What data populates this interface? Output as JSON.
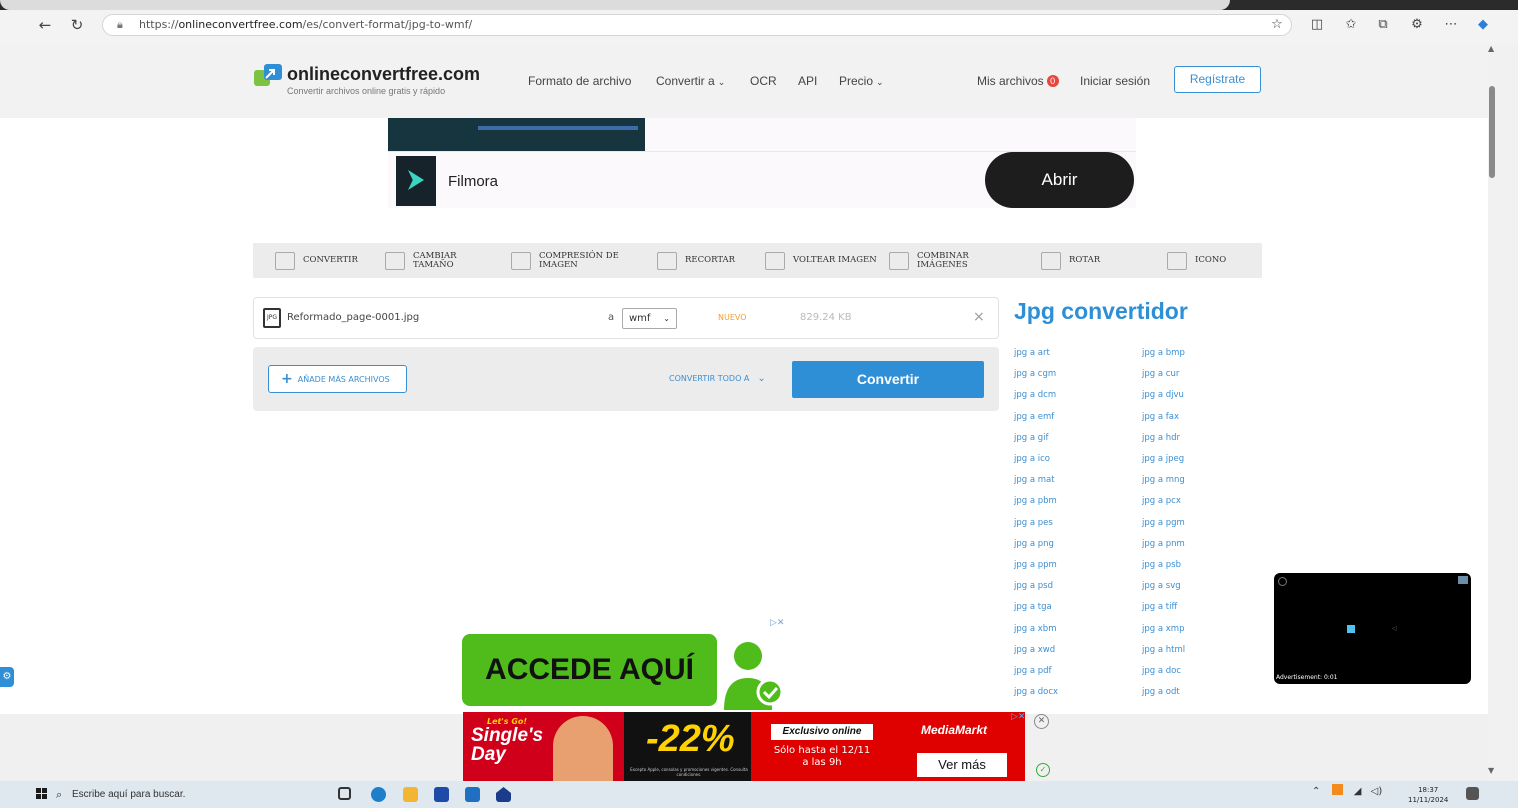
{
  "browser": {
    "url_prefix": "https://",
    "url_host": "onlineconvertfree.com",
    "url_path": "/es/convert-format/jpg-to-wmf/"
  },
  "site": {
    "logo_name": "onlineconvertfree.com",
    "logo_tagline": "Convertir archivos online gratis y rápido",
    "nav": {
      "formato": "Formato de archivo",
      "convertir_a": "Convertir a",
      "ocr": "OCR",
      "api": "API",
      "precio": "Precio"
    },
    "mis_archivos": "Mis archivos",
    "mis_archivos_count": "0",
    "login": "Iniciar sesión",
    "register": "Regístrate"
  },
  "ad_top": {
    "app_name": "Filmora",
    "button": "Abrir"
  },
  "tools": [
    {
      "label": "CONVERTIR",
      "icon": "convert-icon"
    },
    {
      "label": "CAMBIAR TAMAÑO",
      "icon": "resize-icon"
    },
    {
      "label": "COMPRESIÓN DE IMAGEN",
      "icon": "compress-icon"
    },
    {
      "label": "RECORTAR",
      "icon": "crop-icon"
    },
    {
      "label": "VOLTEAR IMAGEN",
      "icon": "flip-icon"
    },
    {
      "label": "COMBINAR IMÁGENES",
      "icon": "combine-icon"
    },
    {
      "label": "ROTAR",
      "icon": "rotate-icon"
    },
    {
      "label": "ICONO",
      "icon": "ico-icon"
    }
  ],
  "converter": {
    "file_icon": "JPG",
    "file_name": "Reformado_page-0001.jpg",
    "to_label": "a",
    "format_selected": "wmf",
    "new_badge": "NUEVO",
    "file_size": "829.24 KB",
    "add_files": "AÑADE MÁS ARCHIVOS",
    "convert_all": "CONVERTIR TODO A",
    "convert_button": "Convertir"
  },
  "jpg_converter": {
    "title": "Jpg convertidor",
    "col1": [
      "jpg a art",
      "jpg a cgm",
      "jpg a dcm",
      "jpg a emf",
      "jpg a gif",
      "jpg a ico",
      "jpg a mat",
      "jpg a pbm",
      "jpg a pes",
      "jpg a png",
      "jpg a ppm",
      "jpg a psd",
      "jpg a tga",
      "jpg a xbm",
      "jpg a xwd",
      "jpg a pdf",
      "jpg a docx"
    ],
    "col2": [
      "jpg a bmp",
      "jpg a cur",
      "jpg a djvu",
      "jpg a fax",
      "jpg a hdr",
      "jpg a jpeg",
      "jpg a mng",
      "jpg a pcx",
      "jpg a pgm",
      "jpg a pnm",
      "jpg a psb",
      "jpg a svg",
      "jpg a tiff",
      "jpg a xmp",
      "jpg a html",
      "jpg a doc",
      "jpg a odt"
    ]
  },
  "ads": {
    "accede": "ACCEDE AQUÍ",
    "mm_lets": "Let's Go!",
    "mm_single1": "Single's",
    "mm_single2": "Day",
    "mm_discount": "-22%",
    "mm_small": "Excepto Apple, consolas y promociones vigentes. Consulta condiciones.",
    "mm_excl": "Exclusivo online",
    "mm_until1": "Sólo hasta el 12/11",
    "mm_until2": "a las 9h",
    "mm_logo": "MediaMarkt",
    "mm_ver": "Ver más",
    "video_label": "Advertisement: 0:01"
  },
  "taskbar": {
    "search_placeholder": "Escribe aquí para buscar.",
    "time": "18:37",
    "date": "11/11/2024"
  }
}
